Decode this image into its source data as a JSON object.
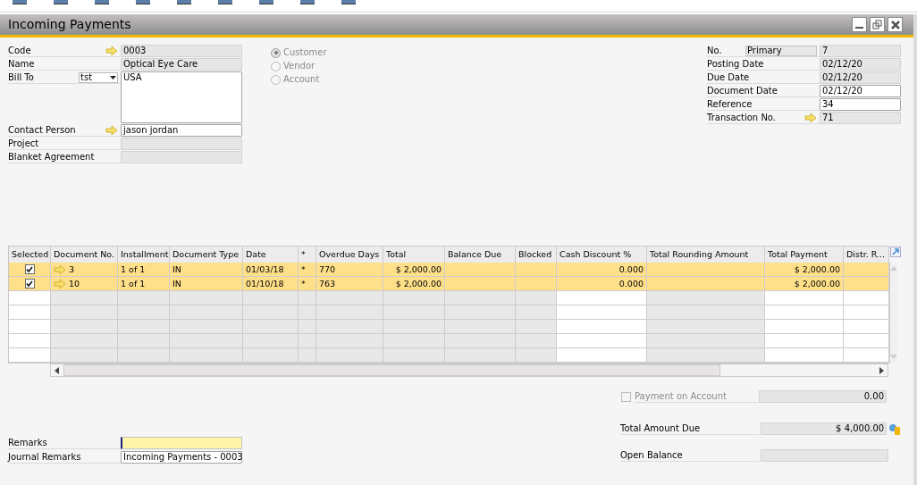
{
  "window": {
    "title": "Incoming Payments"
  },
  "header_left": [
    {
      "kind": "field",
      "label": "Code",
      "value": "0003",
      "link": true,
      "editable": false
    },
    {
      "kind": "field",
      "label": "Name",
      "value": "Optical Eye Care",
      "link": false,
      "editable": false
    },
    {
      "kind": "address",
      "label": "Bill To",
      "dropdown": "tst",
      "value": "USA",
      "link": false,
      "editable": true
    },
    {
      "kind": "field",
      "label": "Contact Person",
      "value": "jason jordan",
      "link": true,
      "editable": true
    },
    {
      "kind": "field",
      "label": "Project",
      "link": false,
      "editable": false
    },
    {
      "kind": "field",
      "label": "Blanket Agreement",
      "link": false,
      "editable": false
    }
  ],
  "partner_type": [
    {
      "label": "Customer",
      "selected": true
    },
    {
      "label": "Vendor",
      "selected": false
    },
    {
      "label": "Account",
      "selected": false
    }
  ],
  "header_right": [
    {
      "label": "No.",
      "series": "Primary",
      "value": "7",
      "link": false,
      "editable": false
    },
    {
      "label": "Posting Date",
      "value": "02/12/20",
      "link": false,
      "editable": false
    },
    {
      "label": "Due Date",
      "value": "02/12/20",
      "link": false,
      "editable": false
    },
    {
      "label": "Document Date",
      "value": "02/12/20",
      "link": false,
      "editable": true
    },
    {
      "label": "Reference",
      "value": "34",
      "link": false,
      "editable": true
    },
    {
      "label": "Transaction No.",
      "value": "71",
      "link": true,
      "editable": false
    }
  ],
  "table": {
    "columns": [
      {
        "label": "Selected",
        "editable": true,
        "kind": "check"
      },
      {
        "label": "Document No.",
        "editable": false,
        "kind": "link"
      },
      {
        "label": "Installment",
        "editable": false,
        "kind": "text"
      },
      {
        "label": "Document Type",
        "editable": false,
        "kind": "text"
      },
      {
        "label": "Date",
        "editable": false,
        "kind": "text"
      },
      {
        "label": "*",
        "editable": false,
        "kind": "text"
      },
      {
        "label": "Overdue Days",
        "editable": false,
        "kind": "text"
      },
      {
        "label": "Total",
        "editable": false,
        "kind": "amount"
      },
      {
        "label": "Balance Due",
        "editable": false,
        "kind": "amount"
      },
      {
        "label": "Blocked",
        "editable": false,
        "kind": "text"
      },
      {
        "label": "Cash Discount %",
        "editable": true,
        "kind": "amount"
      },
      {
        "label": "Total Rounding Amount",
        "editable": false,
        "kind": "amount"
      },
      {
        "label": "Total Payment",
        "editable": true,
        "kind": "amount"
      },
      {
        "label": "Distr. R...",
        "editable": true,
        "kind": "text"
      }
    ],
    "rows": [
      {
        "checked": true,
        "cells": [
          "",
          "3",
          "1 of 1",
          "IN",
          "01/03/18",
          "*",
          "770",
          "$ 2,000.00",
          "",
          "",
          "0.000",
          "",
          "$ 2,000.00",
          ""
        ]
      },
      {
        "checked": true,
        "cells": [
          "",
          "10",
          "1 of 1",
          "IN",
          "01/10/18",
          "*",
          "763",
          "$ 2,000.00",
          "",
          "",
          "0.000",
          "",
          "$ 2,000.00",
          ""
        ]
      }
    ]
  },
  "payment_on_account": {
    "label": "Payment on Account",
    "checked": false,
    "value": "0.00"
  },
  "totals": [
    {
      "label": "Total Amount Due",
      "value": "$ 4,000.00"
    },
    {
      "label": "Open Balance"
    }
  ],
  "remarks": [
    {
      "label": "Remarks",
      "focused": true
    },
    {
      "label": "Journal Remarks",
      "value": "Incoming Payments - 0003",
      "focused": false
    }
  ]
}
